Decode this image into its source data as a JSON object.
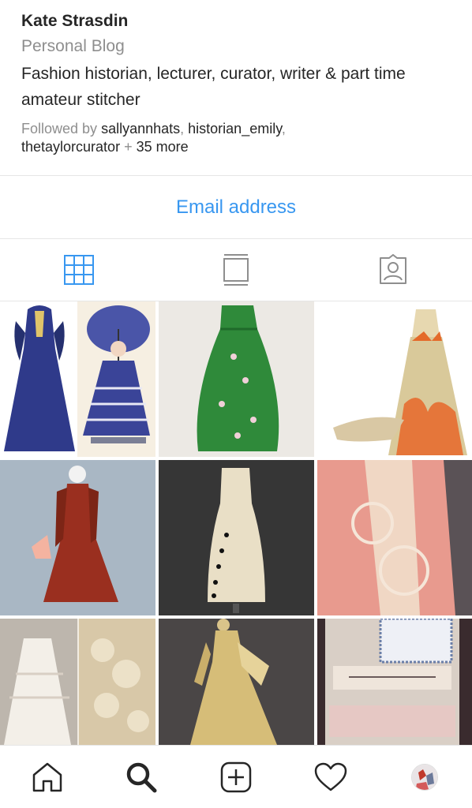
{
  "profile": {
    "name": "Kate Strasdin",
    "category": "Personal Blog",
    "bio": "Fashion historian, lecturer, curator, writer & part time amateur stitcher",
    "followed_prefix": "Followed by ",
    "followers": [
      "sallyannhats",
      "historian_emily",
      "thetaylorcurator"
    ],
    "sep": ", ",
    "plus": " + ",
    "more": "35 more"
  },
  "actions": {
    "email_label": "Email address"
  },
  "tabs": [
    {
      "name": "grid",
      "icon": "grid-icon",
      "active": true
    },
    {
      "name": "feed",
      "icon": "feed-icon",
      "active": false
    },
    {
      "name": "tagged",
      "icon": "tagged-icon",
      "active": false
    }
  ],
  "posts": [
    {
      "icon": "post-image",
      "theme": "blue-victorian-gown-and-illustration"
    },
    {
      "icon": "post-image",
      "theme": "green-embroidered-dress"
    },
    {
      "icon": "post-image",
      "theme": "feather-skirt-gown"
    },
    {
      "icon": "post-image",
      "theme": "red-bustle-dress"
    },
    {
      "icon": "post-image",
      "theme": "cream-button-dress"
    },
    {
      "icon": "post-image",
      "theme": "pink-lace-jacket"
    },
    {
      "icon": "post-image",
      "theme": "white-lace-garments"
    },
    {
      "icon": "post-image",
      "theme": "gold-silk-gown"
    },
    {
      "icon": "post-image",
      "theme": "lace-quilt-detail"
    }
  ],
  "bottom_nav": [
    {
      "name": "home",
      "icon": "home-icon"
    },
    {
      "name": "search",
      "icon": "search-icon"
    },
    {
      "name": "new-post",
      "icon": "plus-square-icon"
    },
    {
      "name": "activity",
      "icon": "heart-icon"
    },
    {
      "name": "profile",
      "icon": "avatar"
    }
  ],
  "colors": {
    "link_blue": "#3897f0",
    "muted": "#8e8e8e",
    "text": "#262626",
    "divider": "#e6e6e6"
  }
}
